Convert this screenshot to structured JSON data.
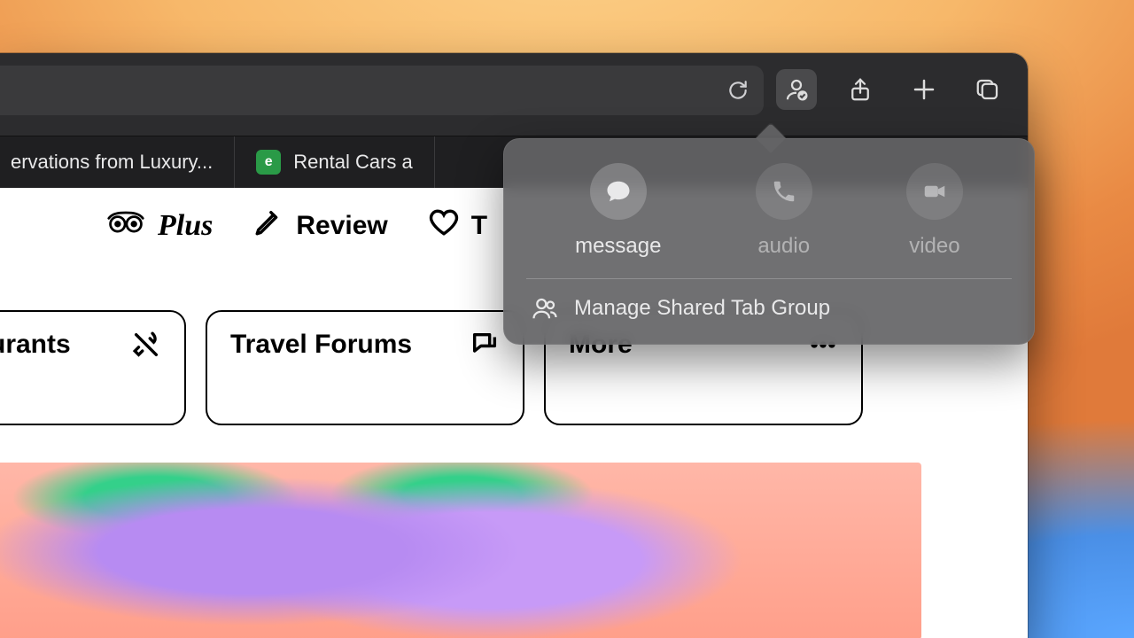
{
  "toolbar": {
    "icons": {
      "reload": "reload-icon",
      "collaborate": "people-check-icon",
      "share": "share-icon",
      "new_tab": "plus-icon",
      "tabs": "tabs-overview-icon"
    }
  },
  "tabs": [
    {
      "label": "ervations from Luxury..."
    },
    {
      "label": "Rental Cars a",
      "favicon": "e"
    }
  ],
  "nav": {
    "plus": "Plus",
    "review": "Review",
    "trips_partial": "T"
  },
  "cards": {
    "restaurants_partial": "urants",
    "forums": "Travel Forums",
    "more": "More"
  },
  "popover": {
    "options": [
      {
        "key": "message",
        "label": "message",
        "active": true
      },
      {
        "key": "audio",
        "label": "audio",
        "active": false
      },
      {
        "key": "video",
        "label": "video",
        "active": false
      }
    ],
    "manage": "Manage Shared Tab Group"
  }
}
